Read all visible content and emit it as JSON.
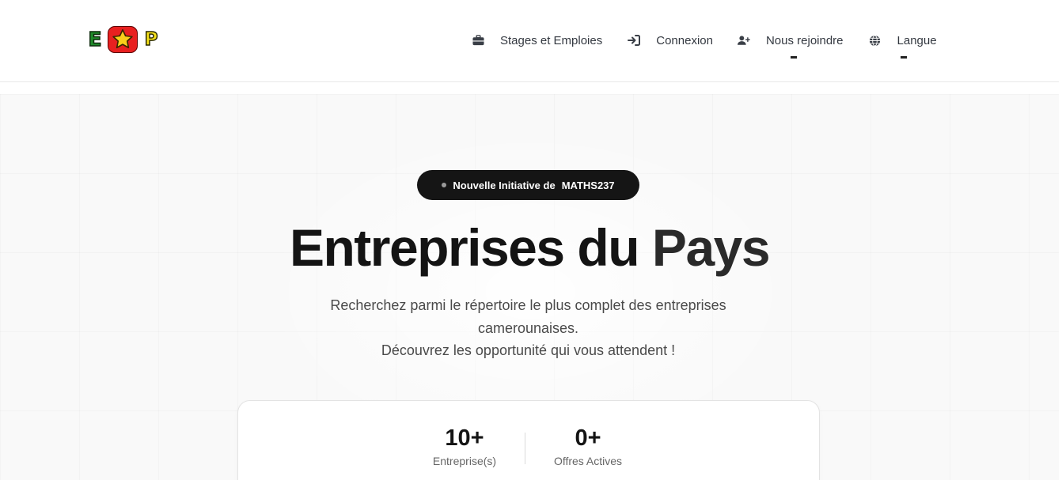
{
  "logo": {
    "letters": [
      "E",
      "P"
    ],
    "star": "star-icon"
  },
  "nav": {
    "items": [
      {
        "icon": "briefcase-icon",
        "label": "Stages et Emploies"
      },
      {
        "icon": "sign-in-icon",
        "label": "Connexion"
      },
      {
        "icon": "user-plus-icon",
        "label": "Nous rejoindre"
      },
      {
        "icon": "globe-icon",
        "label": "Langue"
      }
    ]
  },
  "hero": {
    "badge_text": "Nouvelle Initiative de",
    "badge_brand": "MATHS237",
    "title_main": "Entreprises du",
    "title_accent": "Pays",
    "subtitle_line1": "Recherchez parmi le répertoire le plus complet des entreprises camerounaises.",
    "subtitle_line2": "Découvrez les opportunité qui vous attendent !"
  },
  "stats": [
    {
      "value": "10+",
      "label": "Entreprise(s)"
    },
    {
      "value": "0+",
      "label": "Offres Actives"
    }
  ],
  "colors": {
    "logo_green": "#1f8a2a",
    "logo_red": "#e82020",
    "logo_yellow": "#f7e21a",
    "badge_bg": "#151515"
  }
}
